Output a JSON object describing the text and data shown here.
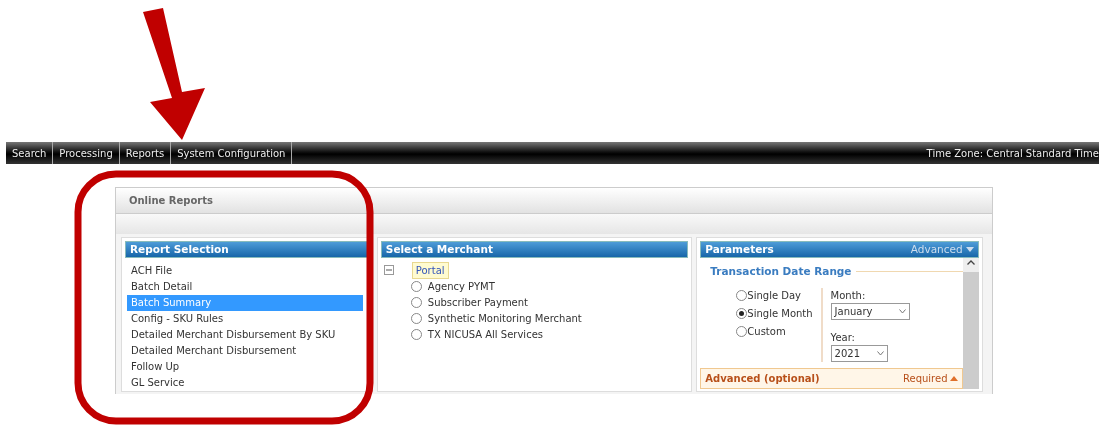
{
  "nav": {
    "items": [
      {
        "label": "Search"
      },
      {
        "label": "Processing"
      },
      {
        "label": "Reports"
      },
      {
        "label": "System Configuration"
      }
    ],
    "timezone": "Time Zone: Central Standard Time"
  },
  "panel": {
    "title": "Online Reports"
  },
  "report_selection": {
    "title": "Report Selection",
    "items": [
      {
        "label": "ACH File",
        "selected": false
      },
      {
        "label": "Batch Detail",
        "selected": false
      },
      {
        "label": "Batch Summary",
        "selected": true
      },
      {
        "label": "Config - SKU Rules",
        "selected": false
      },
      {
        "label": "Detailed Merchant Disbursement By SKU",
        "selected": false
      },
      {
        "label": "Detailed Merchant Disbursement",
        "selected": false
      },
      {
        "label": "Follow Up",
        "selected": false
      },
      {
        "label": "GL Service",
        "selected": false
      }
    ]
  },
  "merchant": {
    "title": "Select a Merchant",
    "root": {
      "label": "Portal",
      "expanded": true,
      "selected": true,
      "children": [
        {
          "label": "Agency PYMT",
          "selected": false
        },
        {
          "label": "Subscriber Payment",
          "selected": false
        },
        {
          "label": "Synthetic Monitoring Merchant",
          "selected": false
        },
        {
          "label": "TX NICUSA All Services",
          "selected": false
        }
      ]
    }
  },
  "parameters": {
    "title": "Parameters",
    "mode": "Advanced",
    "section": "Transaction Date Range",
    "options": [
      {
        "label": "Single Day",
        "selected": false
      },
      {
        "label": "Single Month",
        "selected": true
      },
      {
        "label": "Custom",
        "selected": false
      }
    ],
    "month": {
      "label": "Month:",
      "value": "January"
    },
    "year": {
      "label": "Year:",
      "value": "2021"
    },
    "advanced": {
      "title": "Advanced (optional)",
      "note": "Required"
    }
  }
}
